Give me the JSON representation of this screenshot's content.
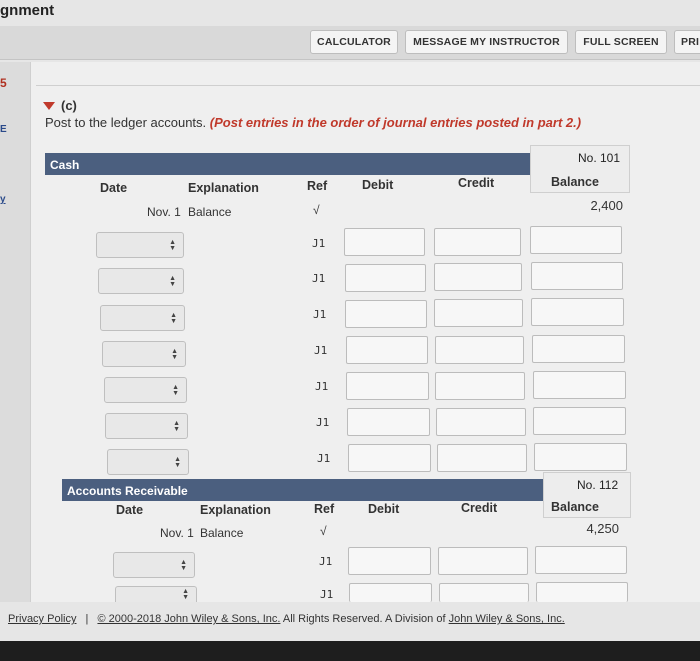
{
  "page": {
    "title": "gnment"
  },
  "toolbar": {
    "calculator": "CALCULATOR",
    "message": "MESSAGE MY INSTRUCTOR",
    "fullscreen": "FULL SCREEN",
    "print": "PRI"
  },
  "left_strip": {
    "glyph_a": "5",
    "glyph_b": "E",
    "glyph_c": "y"
  },
  "section": {
    "letter": "(c)",
    "instruction": "Post to the ledger accounts.",
    "instruction_emph": "(Post entries in the order of journal entries posted in part 2.)"
  },
  "columns": {
    "date": "Date",
    "explanation": "Explanation",
    "ref": "Ref",
    "debit": "Debit",
    "credit": "Credit",
    "balance": "Balance"
  },
  "cash": {
    "name": "Cash",
    "number": "No. 101",
    "opening_date": "Nov. 1",
    "opening_explanation": "Balance",
    "opening_ref": "√",
    "opening_balance": "2,400",
    "row_ref": "J1"
  },
  "receivable": {
    "name": "Accounts Receivable",
    "number": "No. 112",
    "opening_date": "Nov. 1",
    "opening_explanation": "Balance",
    "opening_ref": "√",
    "opening_balance": "4,250",
    "row_ref": "J1"
  },
  "footer": {
    "privacy": "Privacy Policy",
    "separator": "|",
    "copyright": "© 2000-2018 John Wiley & Sons, Inc.",
    "rights": "All Rights Reserved. A Division of",
    "company": "John Wiley & Sons, Inc."
  }
}
